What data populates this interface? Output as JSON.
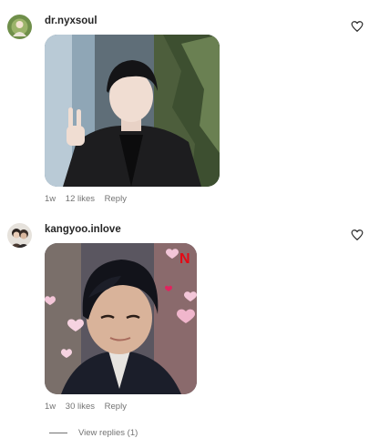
{
  "comments": [
    {
      "username": "dr.nyxsoul",
      "time": "1w",
      "likes": "12 likes",
      "reply_label": "Reply"
    },
    {
      "username": "kangyoo.inlove",
      "time": "1w",
      "likes": "30 likes",
      "reply_label": "Reply",
      "view_replies": "View replies (1)"
    }
  ],
  "icons": {
    "like": "heart-outline-icon"
  },
  "colors": {
    "text_primary": "#262626",
    "text_secondary": "#737373"
  }
}
